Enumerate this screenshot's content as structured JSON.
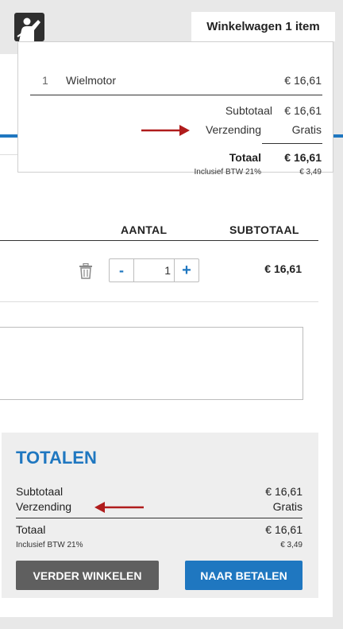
{
  "header": {
    "cart_tab_label": "Winkelwagen 1 item"
  },
  "minicart": {
    "item": {
      "qty": "1",
      "name": "Wielmotor",
      "price": "€ 16,61"
    },
    "subtotal_label": "Subtotaal",
    "subtotal_value": "€ 16,61",
    "shipping_label": "Verzending",
    "shipping_value": "Gratis",
    "total_label": "Totaal",
    "total_value": "€ 16,61",
    "vat_label": "Inclusief BTW 21%",
    "vat_value": "€ 3,49"
  },
  "cart_table": {
    "col_quantity": "AANTAL",
    "col_subtotal": "SUBTOTAAL",
    "row": {
      "quantity": "1",
      "subtotal": "€ 16,61"
    },
    "minus_label": "-",
    "plus_label": "+"
  },
  "totals": {
    "title": "TOTALEN",
    "subtotal_label": "Subtotaal",
    "subtotal_value": "€ 16,61",
    "shipping_label": "Verzending",
    "shipping_value": "Gratis",
    "total_label": "Totaal",
    "total_value": "€ 16,61",
    "vat_label": "Inclusief BTW 21%",
    "vat_value": "€ 3,49",
    "continue_button": "VERDER WINKELEN",
    "checkout_button": "NAAR BETALEN"
  },
  "colors": {
    "accent": "#1f77c0",
    "annotation_arrow": "#b01c1c",
    "secondary_button": "#5f5f5f"
  },
  "icons": [
    "logo-icon",
    "trash-icon",
    "red-arrow-annotation"
  ]
}
